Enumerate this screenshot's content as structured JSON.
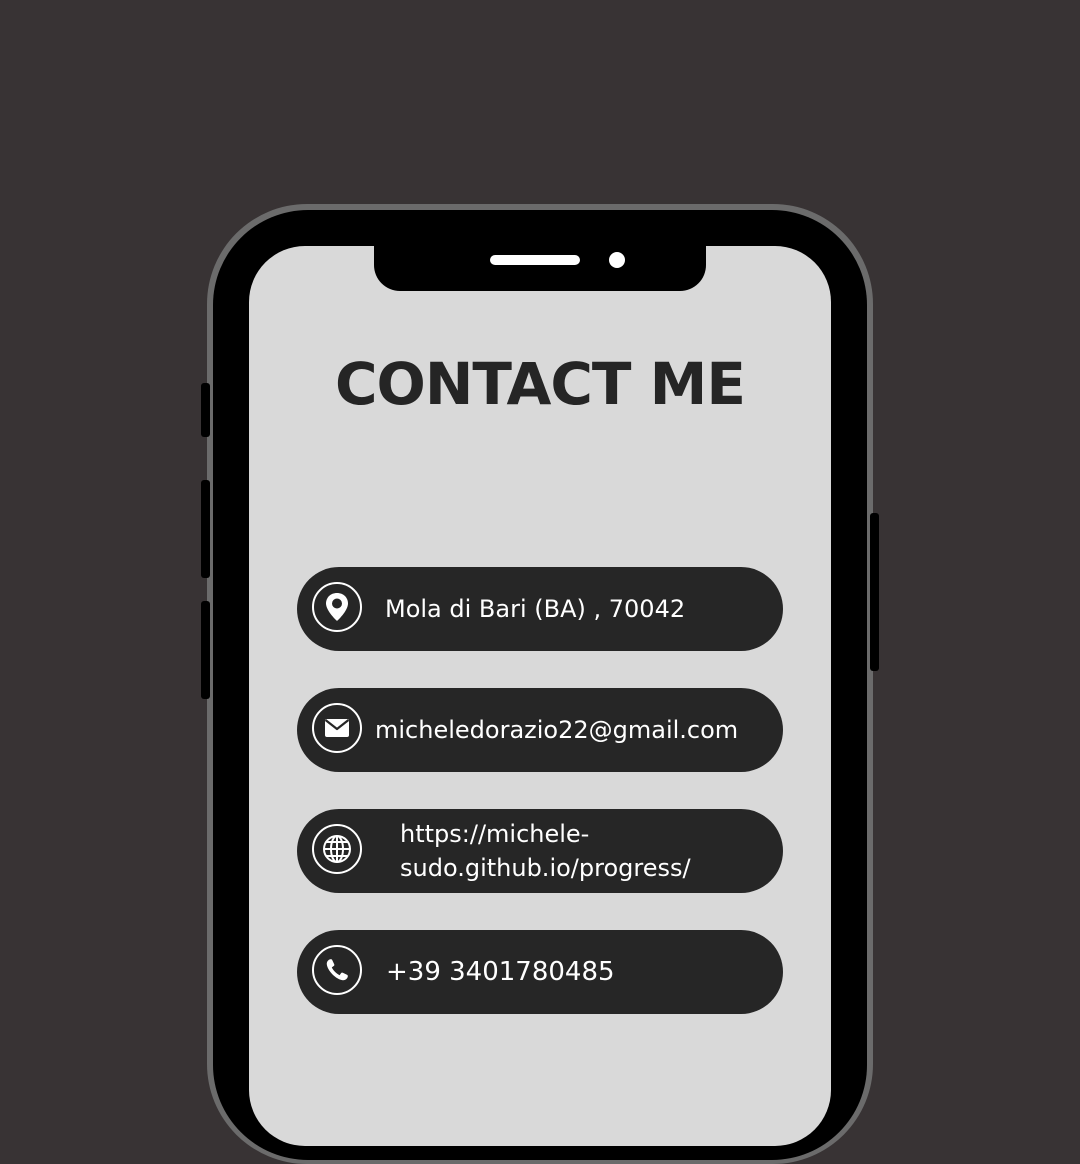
{
  "page": {
    "title": "CONTACT ME"
  },
  "contacts": [
    {
      "icon": "location-pin-icon",
      "text": "Mola di Bari (BA) , 70042"
    },
    {
      "icon": "envelope-icon",
      "text": "micheledorazio22@gmail.com"
    },
    {
      "icon": "globe-icon",
      "line1": "https://michele-",
      "line2": "sudo.github.io/progress/"
    },
    {
      "icon": "phone-icon",
      "text": "+39 3401780485"
    }
  ],
  "colors": {
    "background": "#383334",
    "screen": "#d9d9d9",
    "pill": "#262626",
    "title": "#252525"
  }
}
